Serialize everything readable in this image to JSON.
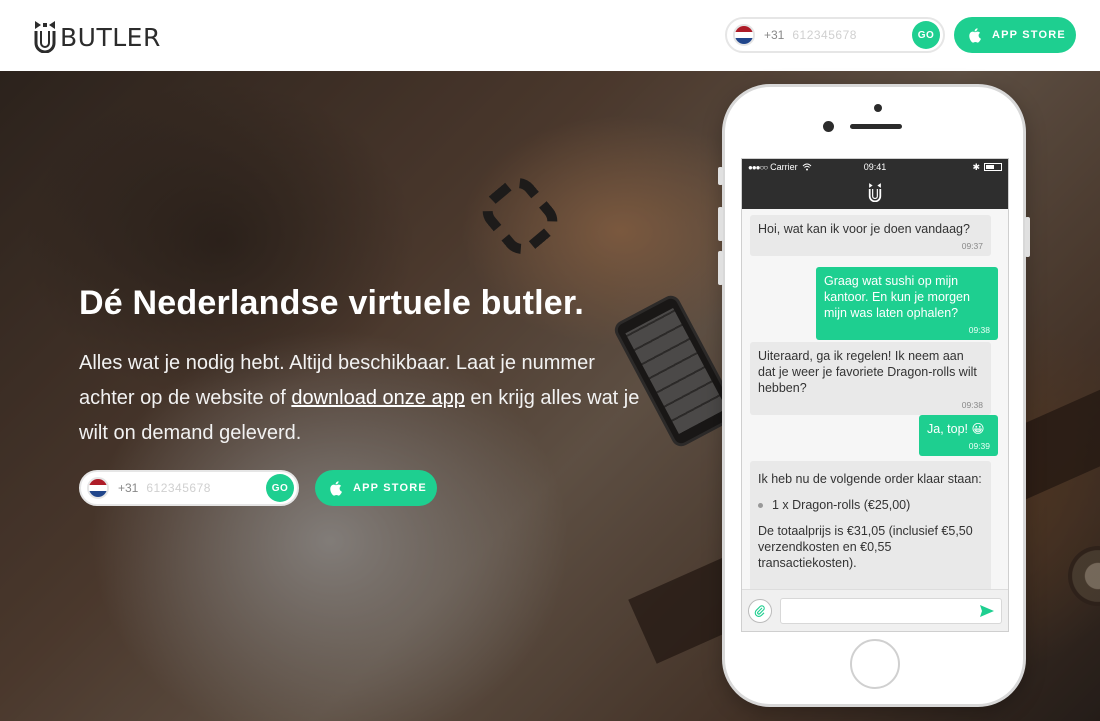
{
  "header": {
    "logo_text": "BUTLER",
    "phone": {
      "country_code": "+31",
      "placeholder": "612345678",
      "go_label": "GO"
    },
    "app_store_label": "APP STORE"
  },
  "hero": {
    "headline": "Dé Nederlandse virtuele butler.",
    "sub_before": "Alles wat je nodig hebt. Altijd beschikbaar. Laat je nummer achter op de website of ",
    "sub_link": "download onze app",
    "sub_after": " en krijg alles wat je wilt on demand geleverd.",
    "phone": {
      "country_code": "+31",
      "placeholder": "612345678",
      "go_label": "GO"
    },
    "app_store_label": "APP STORE"
  },
  "device": {
    "status": {
      "carrier": "Carrier",
      "time": "09:41"
    },
    "messages": [
      {
        "dir": "in",
        "text": "Hoi, wat kan ik voor je doen vandaag?",
        "time": "09:37"
      },
      {
        "dir": "out",
        "text": "Graag wat sushi op mijn kantoor. En kun je morgen mijn was laten ophalen?",
        "time": "09:38"
      },
      {
        "dir": "in",
        "text": "Uiteraard, ga ik regelen! Ik neem aan dat je weer je favoriete Dragon-rolls wilt hebben?",
        "time": "09:38"
      },
      {
        "dir": "out",
        "text": "Ja, top! 😀",
        "time": "09:39"
      }
    ],
    "order": {
      "intro": "Ik heb nu de volgende order klaar staan:",
      "item": "1 x Dragon-rolls (€25,00)",
      "total": "De totaalprijs is €31,05 (inclusief €5,50 verzendkosten en €0,55 transactiekosten)."
    }
  },
  "colors": {
    "accent": "#1ecf90",
    "dark": "#2e2e2e"
  },
  "icons": [
    "bowtie-logo-icon",
    "nl-flag-icon",
    "apple-icon",
    "wifi-icon",
    "bluetooth-icon",
    "battery-icon",
    "paperclip-icon",
    "send-icon"
  ]
}
